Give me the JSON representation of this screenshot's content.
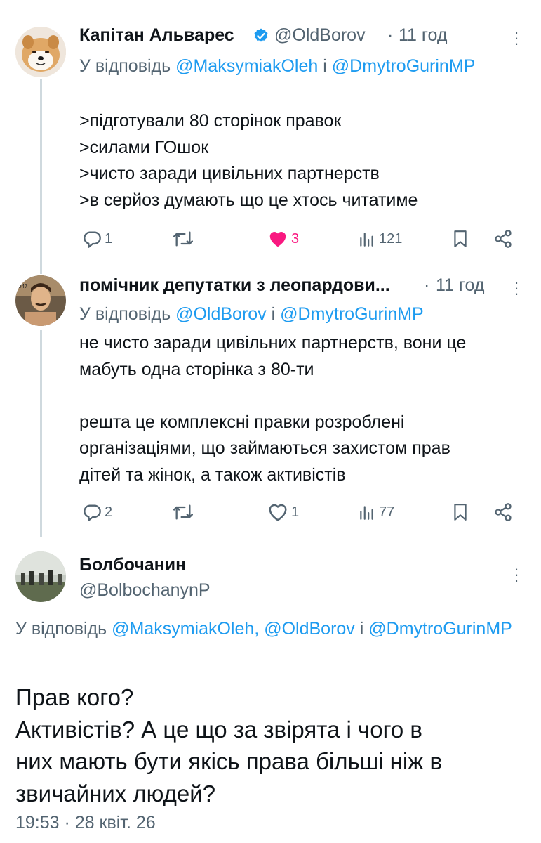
{
  "tweets": [
    {
      "author": "Капітан Альварес",
      "handle": "@OldBorov",
      "sep": "·",
      "time": "11 год",
      "reply_prefix": "У відповідь",
      "reply_mention_1": "@MaksymiakOleh",
      "reply_joiner": "і",
      "reply_mention_2": "@DmytroGurinMP",
      "lines": [
        ">підготували 80 сторінок правок",
        ">силами ГОшок",
        ">чисто заради цивільних партнерств",
        ">в серйоз думають що це хтось читатиме"
      ],
      "replies": "1",
      "retweets": "",
      "likes": "3",
      "views": "121",
      "liked": true,
      "verified": true
    },
    {
      "author": "помічник депутатки з леопардови...",
      "sep": "·",
      "time": "11 год",
      "reply_prefix": "У відповідь",
      "reply_mention_1": "@OldBorov",
      "reply_joiner": "і",
      "reply_mention_2": "@DmytroGurinMP",
      "lines": [
        "не чисто заради цивільних партнерств, вони це",
        "мабуть одна сторінка з 80-ти",
        "",
        "решта це комплексні правки розроблені",
        "організаціями, що займаються захистом прав",
        "дітей та жінок, а також активістів"
      ],
      "replies": "2",
      "retweets": "",
      "likes": "1",
      "views": "77",
      "liked": false
    }
  ],
  "main_tweet": {
    "author": "Болбочанин",
    "handle": "@BolbochanynP",
    "reply_prefix": "У відповідь",
    "reply_mention_1": "@MaksymiakOleh,",
    "reply_mention_2": "@OldBorov",
    "reply_joiner": "і",
    "reply_mention_3": "@DmytroGurinMP",
    "lines": [
      "Прав кого?",
      "Активістів? А це що за звірята і чого в",
      "них мають бути якісь права більші ніж в",
      "звичайних людей?"
    ],
    "timestamp": "19:53 · 28 квіт. 26"
  },
  "colors": {
    "text": "#0f1419",
    "muted": "#536471",
    "link": "#1d9bf0",
    "like": "#f91880",
    "verified": "#1d9bf0"
  },
  "icons": [
    "reply-icon",
    "retweet-icon",
    "like-icon",
    "views-icon",
    "bookmark-icon",
    "share-icon",
    "more-icon",
    "verified-badge-icon"
  ]
}
